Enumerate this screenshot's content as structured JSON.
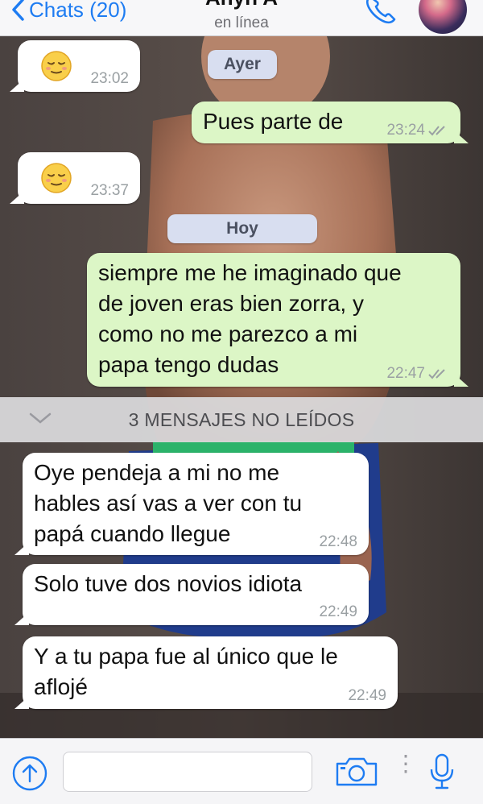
{
  "header": {
    "back_label": "Chats (20)",
    "contact_name": "Anyn A",
    "contact_status": "en línea"
  },
  "date_chips": {
    "yesterday": "Ayer",
    "today": "Hoy"
  },
  "messages": [
    {
      "direction": "incoming",
      "type": "emoji",
      "emoji": "relieved-face",
      "time": "23:02"
    },
    {
      "direction": "outgoing",
      "text": "Pues parte de",
      "time": "23:24",
      "status": "read"
    },
    {
      "direction": "incoming",
      "type": "emoji",
      "emoji": "relieved-face",
      "time": "23:37"
    },
    {
      "direction": "outgoing",
      "lines": [
        "siempre me he imaginado que",
        "de joven eras bien zorra, y",
        "como no me parezco a mi",
        "papa tengo dudas"
      ],
      "time": "22:47",
      "status": "read"
    },
    {
      "direction": "incoming",
      "lines": [
        "Oye pendeja a mi no me",
        "hables así vas a ver con tu",
        "papá cuando llegue"
      ],
      "time": "22:48"
    },
    {
      "direction": "incoming",
      "text": "Solo tuve dos novios idiota",
      "time": "22:49"
    },
    {
      "direction": "incoming",
      "lines": [
        "Y a tu papa fue al único que le",
        "aflojé"
      ],
      "time": "22:49"
    }
  ],
  "unread_banner": "3 MENSAJES NO LEÍDOS",
  "input_bar": {
    "placeholder": ""
  },
  "colors": {
    "accent": "#1e7cf2",
    "outgoing_bubble": "#dcf6c6",
    "incoming_bubble": "#ffffff",
    "date_chip": "#d8def0"
  },
  "icons": {
    "back": "chevron-left-icon",
    "call": "phone-icon",
    "attach": "upload-arrow-icon",
    "camera": "camera-icon",
    "mic": "microphone-icon",
    "read_receipt": "double-check-icon"
  }
}
